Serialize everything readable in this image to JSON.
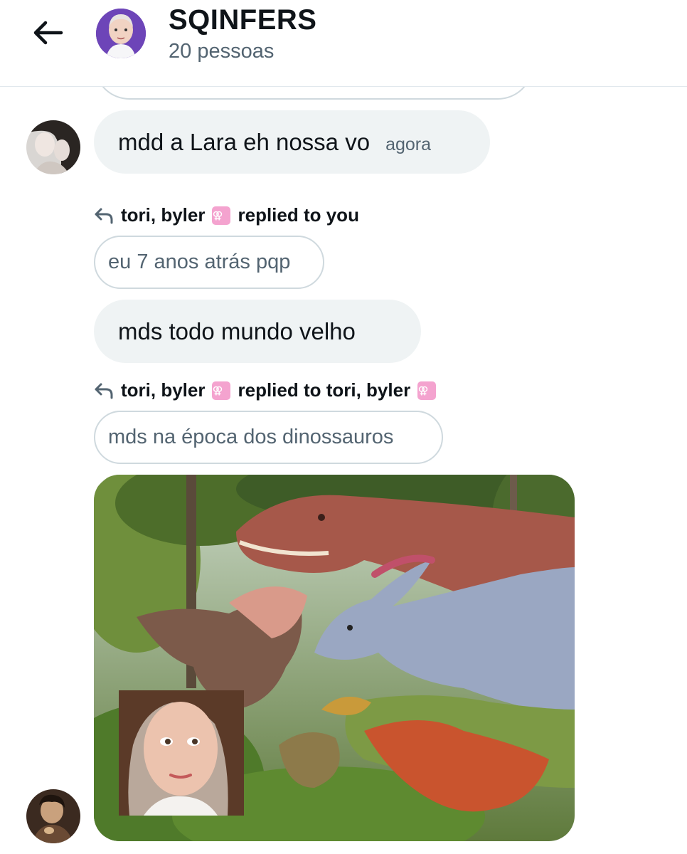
{
  "header": {
    "title": "SQINFERS",
    "subtitle": "20 pessoas"
  },
  "messages": [
    {
      "text": "mdd a Lara eh nossa vo",
      "time": "agora"
    },
    {
      "reply_prefix": "tori, byler",
      "reply_suffix": "replied to you",
      "quoted": "eu 7 anos atrás pqp",
      "text": "mds todo mundo velho"
    },
    {
      "reply_prefix": "tori, byler",
      "reply_mid": "replied to tori, byler",
      "quoted": "mds na época dos dinossauros"
    }
  ],
  "colors": {
    "bubble_grey": "#eff3f4",
    "outline": "#cfd9de",
    "secondary_text": "#536471",
    "emoji_pink": "#f4a3cf"
  },
  "icons": [
    "back-arrow-icon",
    "reply-arrow-icon",
    "venus-symbol-icon"
  ]
}
